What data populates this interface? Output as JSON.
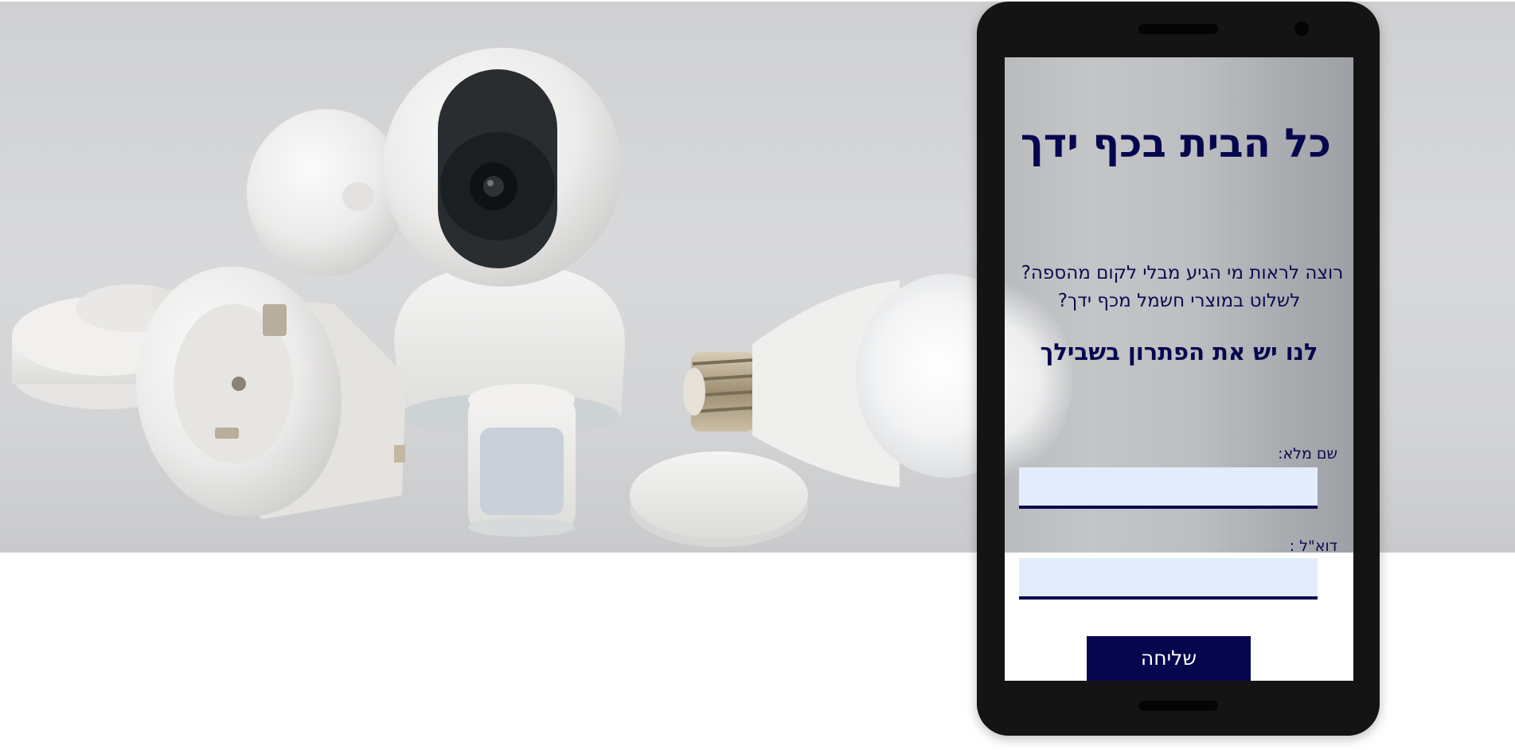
{
  "hero": {
    "image_name": "smart-home-devices-photo"
  },
  "signup": {
    "headline": "כל הבית בכף ידך",
    "question_line1": "רוצה לראות מי הגיע מבלי לקום מהספה?",
    "question_line2": "לשלוט במוצרי חשמל מכף ידך?",
    "tagline": "לנו יש את הפתרון בשבילך",
    "name_label": "שם מלא:",
    "name_value": "",
    "email_label": "דוא\"ל :",
    "email_value": "",
    "submit_label": "שליחה"
  },
  "colors": {
    "brand_navy": "#06064f",
    "input_bg": "#e3ecfb",
    "phone_frame": "#141414"
  }
}
